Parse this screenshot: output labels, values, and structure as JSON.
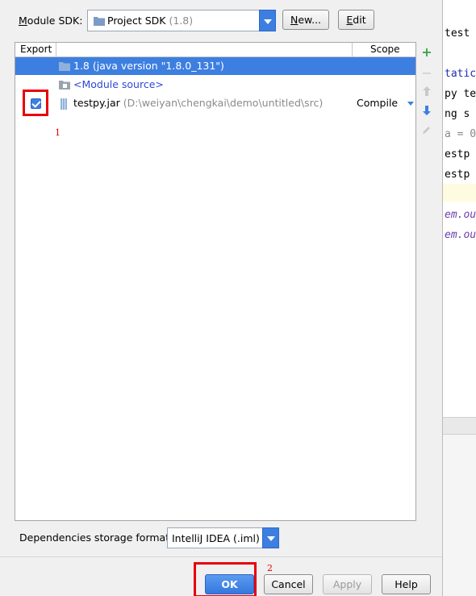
{
  "sdk": {
    "label_pre": "",
    "label_underline": "M",
    "label_post": "odule SDK:",
    "value": "Project SDK",
    "version": "(1.8)",
    "new_underline": "N",
    "new_rest": "ew...",
    "edit_underline": "E",
    "edit_rest": "dit"
  },
  "table": {
    "headers": {
      "export": "Export",
      "scope": "Scope"
    },
    "rows": [
      {
        "label": "1.8 (java version \"1.8.0_131\")",
        "icon": "folder-icon",
        "selected": true
      },
      {
        "label": "<Module source>",
        "icon": "folder-icon"
      },
      {
        "label": "testpy.jar",
        "path": "(D:\\weiyan\\chengkai\\demo\\untitled\\src)",
        "scope": "Compile",
        "icon": "jar-icon",
        "exported": true
      }
    ]
  },
  "annotations": {
    "one": "1",
    "two": "2"
  },
  "storage": {
    "label": "Dependencies storage format:",
    "value": "IntelliJ IDEA (.iml)"
  },
  "buttons": {
    "ok": "OK",
    "cancel": "Cancel",
    "apply": "Apply",
    "help": "Help"
  },
  "editor": {
    "lines": [
      "test",
      "tatic",
      "py te",
      "ng s",
      "a = 0",
      "estp",
      "estp",
      "em.ou",
      "em.ou"
    ]
  },
  "colors": {
    "accent": "#3d7fe0",
    "annotation_red": "#e8000b",
    "add_green": "#3aa84a"
  }
}
